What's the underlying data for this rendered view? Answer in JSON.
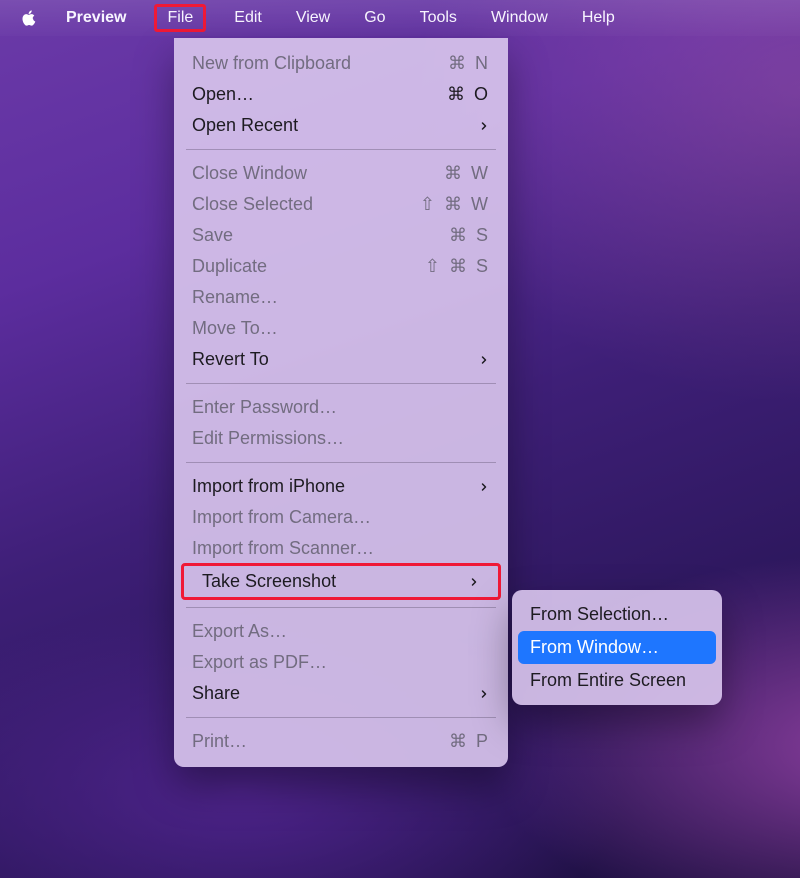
{
  "menubar": {
    "appName": "Preview",
    "items": [
      "File",
      "Edit",
      "View",
      "Go",
      "Tools",
      "Window",
      "Help"
    ],
    "activeIndex": 0
  },
  "fileMenu": {
    "groups": [
      [
        {
          "label": "New from Clipboard",
          "shortcut": "⌘ N",
          "disabled": true,
          "submenu": false
        },
        {
          "label": "Open…",
          "shortcut": "⌘ O",
          "disabled": false,
          "submenu": false
        },
        {
          "label": "Open Recent",
          "shortcut": "",
          "disabled": false,
          "submenu": true
        }
      ],
      [
        {
          "label": "Close Window",
          "shortcut": "⌘ W",
          "disabled": true,
          "submenu": false
        },
        {
          "label": "Close Selected",
          "shortcut": "⇧ ⌘ W",
          "disabled": true,
          "submenu": false
        },
        {
          "label": "Save",
          "shortcut": "⌘ S",
          "disabled": true,
          "submenu": false
        },
        {
          "label": "Duplicate",
          "shortcut": "⇧ ⌘ S",
          "disabled": true,
          "submenu": false
        },
        {
          "label": "Rename…",
          "shortcut": "",
          "disabled": true,
          "submenu": false
        },
        {
          "label": "Move To…",
          "shortcut": "",
          "disabled": true,
          "submenu": false
        },
        {
          "label": "Revert To",
          "shortcut": "",
          "disabled": false,
          "submenu": true
        }
      ],
      [
        {
          "label": "Enter Password…",
          "shortcut": "",
          "disabled": true,
          "submenu": false
        },
        {
          "label": "Edit Permissions…",
          "shortcut": "",
          "disabled": true,
          "submenu": false
        }
      ],
      [
        {
          "label": "Import from iPhone",
          "shortcut": "",
          "disabled": false,
          "submenu": true
        },
        {
          "label": "Import from Camera…",
          "shortcut": "",
          "disabled": true,
          "submenu": false
        },
        {
          "label": "Import from Scanner…",
          "shortcut": "",
          "disabled": true,
          "submenu": false
        },
        {
          "label": "Take Screenshot",
          "shortcut": "",
          "disabled": false,
          "submenu": true,
          "highlight": true
        }
      ],
      [
        {
          "label": "Export As…",
          "shortcut": "",
          "disabled": true,
          "submenu": false
        },
        {
          "label": "Export as PDF…",
          "shortcut": "",
          "disabled": true,
          "submenu": false
        },
        {
          "label": "Share",
          "shortcut": "",
          "disabled": false,
          "submenu": true
        }
      ],
      [
        {
          "label": "Print…",
          "shortcut": "⌘ P",
          "disabled": true,
          "submenu": false
        }
      ]
    ]
  },
  "submenu": {
    "items": [
      {
        "label": "From Selection…",
        "selected": false
      },
      {
        "label": "From Window…",
        "selected": true
      },
      {
        "label": "From Entire Screen",
        "selected": false
      }
    ]
  }
}
